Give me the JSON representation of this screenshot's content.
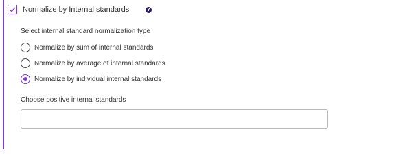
{
  "header": {
    "checkbox_label": "Normalize by Internal standards",
    "checkbox_checked": true,
    "help_glyph": "?"
  },
  "normalization": {
    "section_label": "Select internal standard normalization type",
    "options": [
      {
        "label": "Normalize by sum of internal standards",
        "selected": false
      },
      {
        "label": "Normalize by average of internal standards",
        "selected": false
      },
      {
        "label": "Normalize by individual internal standards",
        "selected": true
      }
    ]
  },
  "positive_standards": {
    "label": "Choose positive internal standards",
    "value": ""
  },
  "colors": {
    "accent": "#7b3fc4",
    "help_icon": "#2a1a5e"
  },
  "icons": {
    "checkbox": "check-icon",
    "help": "question-circle-icon"
  }
}
